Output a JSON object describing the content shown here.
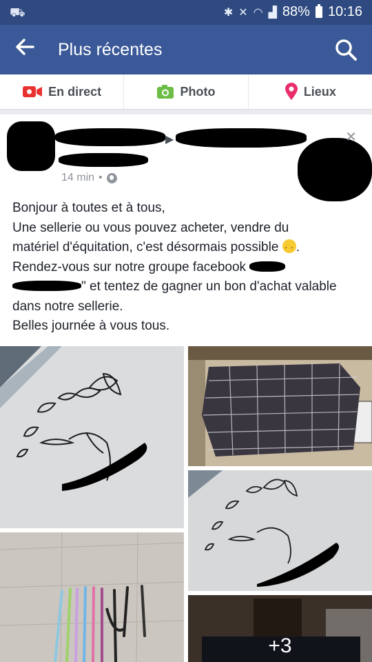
{
  "status_bar": {
    "battery": "88%",
    "time": "10:16"
  },
  "app_bar": {
    "title": "Plus récentes"
  },
  "actions": [
    {
      "label": "En direct",
      "icon": "live-video-icon",
      "color": "#e9322f"
    },
    {
      "label": "Photo",
      "icon": "camera-icon",
      "color": "#6bbd45"
    },
    {
      "label": "Lieux",
      "icon": "location-pin-icon",
      "color": "#ea2e6b"
    }
  ],
  "post": {
    "time": "14 min",
    "text_lines": [
      "Bonjour à toutes et à tous,",
      "Une sellerie ou vous pouvez acheter, vendre du",
      "matériel d'équitation, c'est désormais possible",
      "Rendez-vous sur notre groupe facebook",
      "\" et tentez de gagner un bon d'achat valable",
      "dans notre sellerie.",
      "Belles journée à vous tous."
    ],
    "more_photos": "+3"
  },
  "colors": {
    "brand": "#3b5998",
    "status_bar": "#2f4a80"
  }
}
